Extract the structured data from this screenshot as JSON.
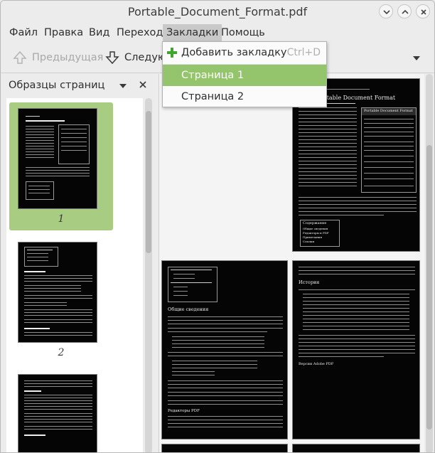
{
  "window": {
    "title": "Portable_Document_Format.pdf"
  },
  "menubar": {
    "items": [
      {
        "label": "Файл"
      },
      {
        "label": "Правка"
      },
      {
        "label": "Вид"
      },
      {
        "label": "Переход"
      },
      {
        "label": "Закладки"
      },
      {
        "label": "Помощь"
      }
    ],
    "active": "Закладки"
  },
  "toolbar": {
    "prev_label": "Предыдущая",
    "next_label": "Следую"
  },
  "sidebar": {
    "title": "Образцы страниц",
    "thumbnails": [
      {
        "number": "1",
        "selected": true
      },
      {
        "number": "2",
        "selected": false
      },
      {
        "number": "",
        "selected": false
      }
    ]
  },
  "bookmarks_menu": {
    "add_label": "Добавить закладку",
    "add_shortcut": "Ctrl+D",
    "items": [
      {
        "label": "Страница 1",
        "highlighted": true
      },
      {
        "label": "Страница 2",
        "highlighted": false
      }
    ]
  },
  "document": {
    "page1_heading": "Portable Document Format",
    "page1_infobox_title": "Portable Document Format",
    "page1_contents_title": "Содержание",
    "page1_contents_items": [
      "Общие сведения",
      "Редакторы и PDF",
      "Примечания",
      "Ссылки"
    ],
    "page2_heading": "Общие сведения",
    "page2_subheading": "Редакторы PDF",
    "page3_heading": "История",
    "page3_subheading": "Версии Adobe PDF"
  },
  "colors": {
    "accent": "#94c46b",
    "thumbnail_selected": "#a9cc83",
    "page_background": "#050505"
  }
}
